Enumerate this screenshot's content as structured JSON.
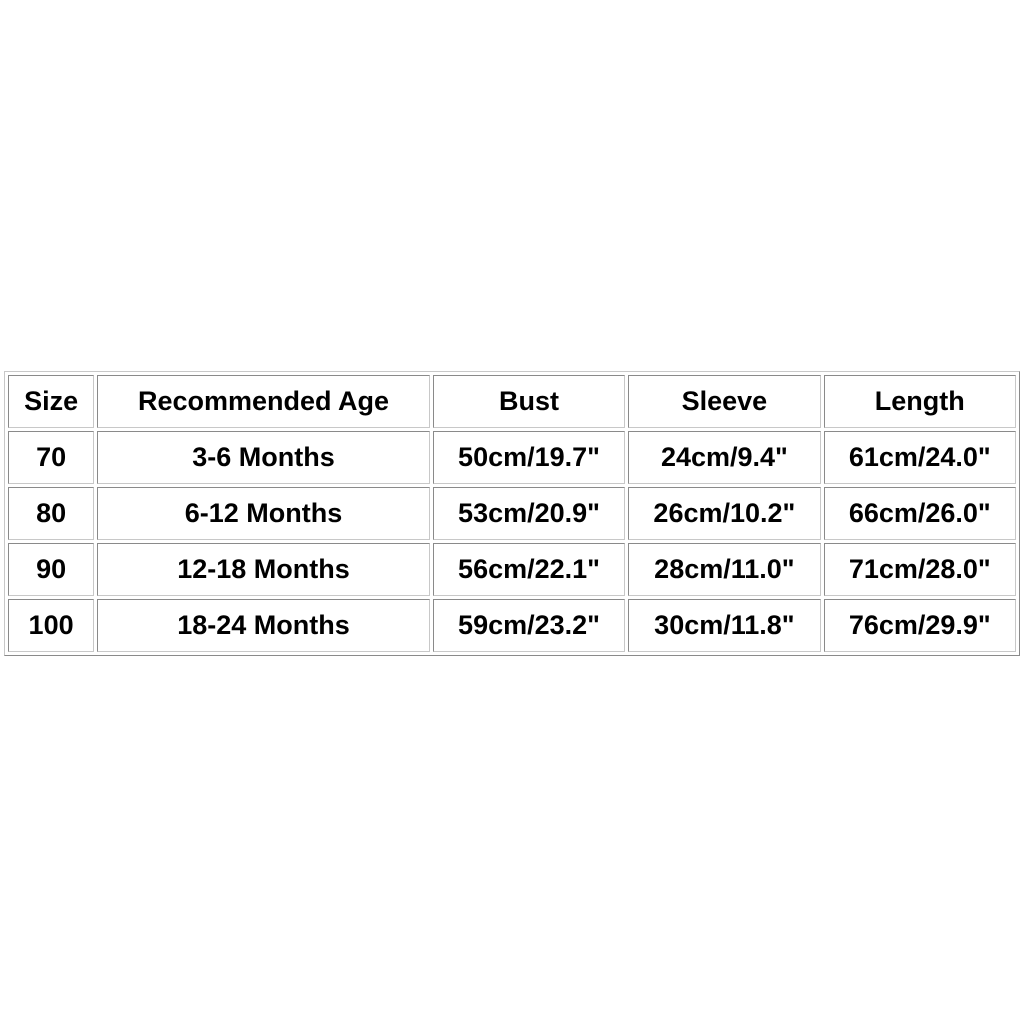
{
  "table": {
    "headers": [
      "Size",
      "Recommended Age",
      "Bust",
      "Sleeve",
      "Length"
    ],
    "rows": [
      [
        "70",
        "3-6 Months",
        "50cm/19.7\"",
        "24cm/9.4\"",
        "61cm/24.0\""
      ],
      [
        "80",
        "6-12 Months",
        "53cm/20.9\"",
        "26cm/10.2\"",
        "66cm/26.0\""
      ],
      [
        "90",
        "12-18 Months",
        "56cm/22.1\"",
        "28cm/11.0\"",
        "71cm/28.0\""
      ],
      [
        "100",
        "18-24 Months",
        "59cm/23.2\"",
        "30cm/11.8\"",
        "76cm/29.9\""
      ]
    ]
  }
}
